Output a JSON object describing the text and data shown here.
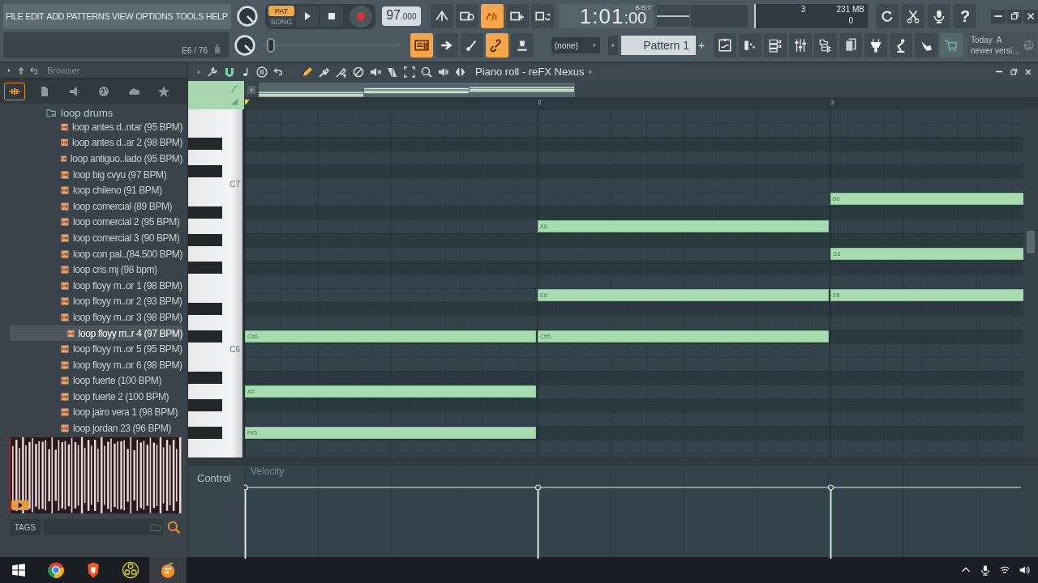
{
  "menu": [
    "FILE",
    "EDIT",
    "ADD",
    "PATTERNS",
    "VIEW",
    "OPTIONS",
    "TOOLS",
    "HELP"
  ],
  "hint_bar": {
    "text": "E6 / 76"
  },
  "transport": {
    "modes": [
      {
        "label": "PAT",
        "selected": true
      },
      {
        "label": "SONG",
        "selected": false
      }
    ]
  },
  "tempo": {
    "whole": "97",
    "fraction": ".000"
  },
  "master_pitch": {
    "level": 0.03
  },
  "toggles_top": [
    {
      "on": false
    },
    {
      "on": false
    },
    {
      "on": true
    },
    {
      "on": false
    },
    {
      "on": false
    }
  ],
  "toggles_bottom": [
    {
      "on": true
    },
    {
      "on": false
    },
    {
      "on": false
    },
    {
      "on": true
    },
    {
      "on": false
    }
  ],
  "song_time": {
    "value": "1:01",
    "sub": ":00",
    "unit": "B:S:T"
  },
  "monitor": {
    "voices": "3",
    "memory": "231 MB",
    "cpu": "0"
  },
  "help_button": {
    "label": "?"
  },
  "snap": {
    "value": "(none)"
  },
  "pattern": {
    "name": "Pattern 1",
    "add_label": "+"
  },
  "news": {
    "line_1": "Today  A",
    "line_2": "newer versi…"
  },
  "browser": {
    "title": "Browser",
    "tabs": [
      {
        "selected": true
      },
      {
        "selected": false
      },
      {
        "selected": false
      },
      {
        "selected": false
      },
      {
        "selected": false
      },
      {
        "selected": false
      }
    ],
    "folder": "loop drums",
    "items": [
      {
        "label": "loop antes d..ntar (95 BPM)",
        "selected": false
      },
      {
        "label": "loop antes d..ar 2 (98 BPM)",
        "selected": false
      },
      {
        "label": "loop antiguo..lado (95 BPM)",
        "selected": false
      },
      {
        "label": "loop big cvyu (97 BPM)",
        "selected": false
      },
      {
        "label": "loop chileno (91 BPM)",
        "selected": false
      },
      {
        "label": "loop comercial (89 BPM)",
        "selected": false
      },
      {
        "label": "loop comercial 2 (95 BPM)",
        "selected": false
      },
      {
        "label": "loop comercial 3 (90 BPM)",
        "selected": false
      },
      {
        "label": "loop con pal..(84.500 BPM)",
        "selected": false
      },
      {
        "label": "loop cris mj (98 bpm)",
        "selected": false
      },
      {
        "label": "loop floyy m..or 1 (98 BPM)",
        "selected": false
      },
      {
        "label": "loop floyy m..or 2 (93 BPM)",
        "selected": false
      },
      {
        "label": "loop floyy m..or 3 (98 BPM)",
        "selected": false
      },
      {
        "label": "loop floyy m..r 4 (97 BPM)",
        "selected": true
      },
      {
        "label": "loop floyy m..or 5 (95 BPM)",
        "selected": false
      },
      {
        "label": "loop floyy m..or 6 (98 BPM)",
        "selected": false
      },
      {
        "label": "loop fuerte (100 BPM)",
        "selected": false
      },
      {
        "label": "loop fuerte 2 (100 BPM)",
        "selected": false
      },
      {
        "label": "loop jairo vera 1 (98 BPM)",
        "selected": false
      },
      {
        "label": "loop jordan 23 (96 BPM)",
        "selected": false
      }
    ],
    "tags_label": "TAGS"
  },
  "piano_roll": {
    "title": "Piano roll - reFX Nexus",
    "magnet": {
      "on": true
    },
    "tools": [
      {
        "selected": true
      },
      {
        "selected": false
      },
      {
        "selected": false
      },
      {
        "selected": false
      },
      {
        "selected": false
      },
      {
        "selected": false
      },
      {
        "selected": false
      },
      {
        "selected": false
      },
      {
        "selected": false
      }
    ],
    "ruler": [
      "2",
      "3"
    ],
    "key_labels": [
      "C7",
      "C6"
    ],
    "notes": [
      {
        "label": "B6"
      },
      {
        "label": "A6"
      },
      {
        "label": "G6"
      },
      {
        "label": "E6"
      },
      {
        "label": "E6"
      },
      {
        "label": "C#6"
      },
      {
        "label": "C#6"
      },
      {
        "label": "A5"
      },
      {
        "label": "F#5"
      }
    ],
    "control": {
      "label": "Control",
      "target": "Velocity"
    }
  }
}
